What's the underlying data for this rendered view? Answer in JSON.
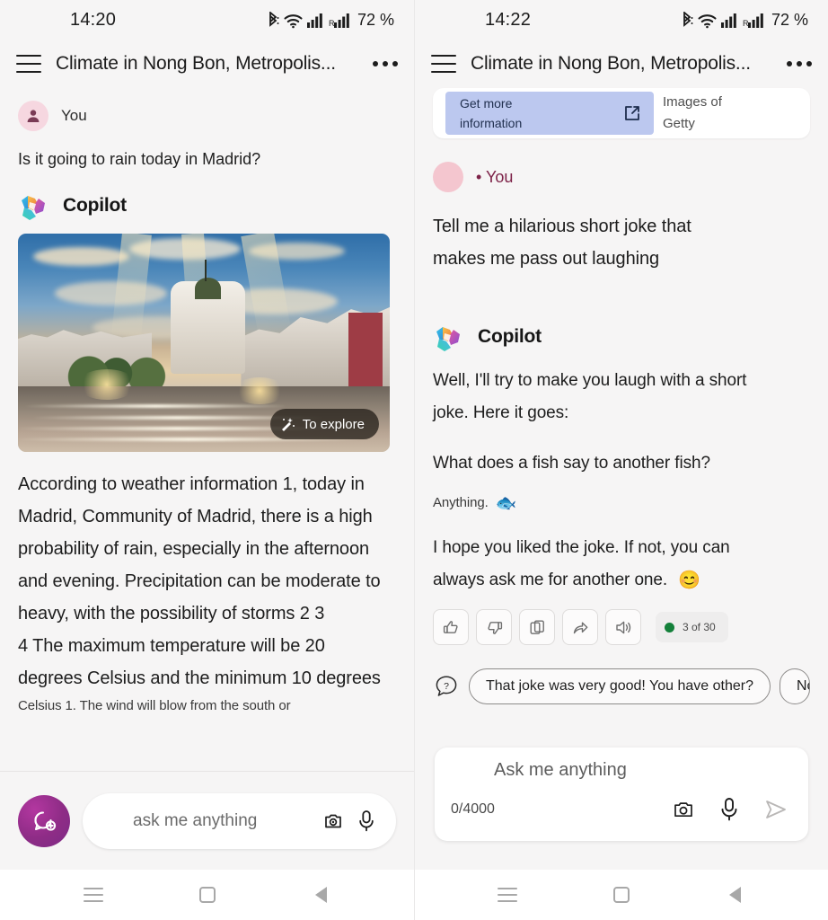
{
  "left": {
    "status": {
      "time": "14:20",
      "battery": "72 %",
      "icons": [
        "bluetooth-icon",
        "wifi-icon",
        "signal-icon",
        "signal-roaming-icon"
      ]
    },
    "header": {
      "menu": "hamburger-menu-icon",
      "title": "Climate in Nong Bon, Metropolis...",
      "overflow": "more-options-icon"
    },
    "user": {
      "name": "You",
      "message": "Is it going to rain today in Madrid?"
    },
    "assistant": {
      "name": "Copilot"
    },
    "image": {
      "alt": "Madrid Gran Via cityscape at sunset",
      "overlay_button": "To explore",
      "overlay_icon": "magic-wand-icon"
    },
    "answer_lines": [
      "According to weather information 1, today in",
      "Madrid, Community of Madrid, there is a high",
      "probability of rain, especially in the afternoon",
      "and evening. Precipitation can be moderate to",
      "heavy, with the possibility of storms 2 3",
      "4 The maximum temperature will be 20",
      "degrees Celsius and the minimum 10 degrees"
    ],
    "answer_cut_line": "Celsius 1. The wind will blow from the south or",
    "composer": {
      "new_chat_icon": "new-chat-icon",
      "placeholder": "ask me anything",
      "camera_icon": "camera-icon",
      "mic_icon": "microphone-icon"
    }
  },
  "right": {
    "status": {
      "time": "14:22",
      "battery": "72 %"
    },
    "header": {
      "title": "Climate in Nong Bon, Metropolis..."
    },
    "source_card": {
      "button_label_line1": "Get more",
      "button_label_line2": "information",
      "external_icon": "external-link-icon",
      "caption_line1": "Images of",
      "caption_line2": "Getty"
    },
    "user": {
      "name": "• You",
      "message_lines": [
        "Tell me a hilarious short joke that",
        "makes me pass out laughing"
      ]
    },
    "assistant": {
      "name": "Copilot"
    },
    "reply_lines": [
      "Well, I'll try to make you laugh with a short",
      "joke. Here it goes:"
    ],
    "joke_question": "What does a fish say to another fish?",
    "joke_answer": "Anything.",
    "joke_emoji": "🐟",
    "closing_lines": [
      "I hope you liked the joke. If not, you can",
      "always ask me for another one."
    ],
    "closing_emoji": "😊",
    "feedback": {
      "buttons": [
        "thumbs-up-icon",
        "thumbs-down-icon",
        "copy-icon",
        "share-icon",
        "speaker-icon"
      ],
      "counter": "3 of 30",
      "counter_dot_color": "#14803a"
    },
    "suggestions": {
      "icon": "question-bubble-icon",
      "chips": [
        "That joke was very good! You have other?",
        "No"
      ]
    },
    "composer": {
      "placeholder": "Ask me anything",
      "counter": "0/4000",
      "camera_icon": "camera-icon",
      "mic_icon": "microphone-icon",
      "send_icon": "send-icon"
    }
  },
  "navbar": {
    "items": [
      "recents-icon",
      "home-icon",
      "back-icon"
    ]
  }
}
